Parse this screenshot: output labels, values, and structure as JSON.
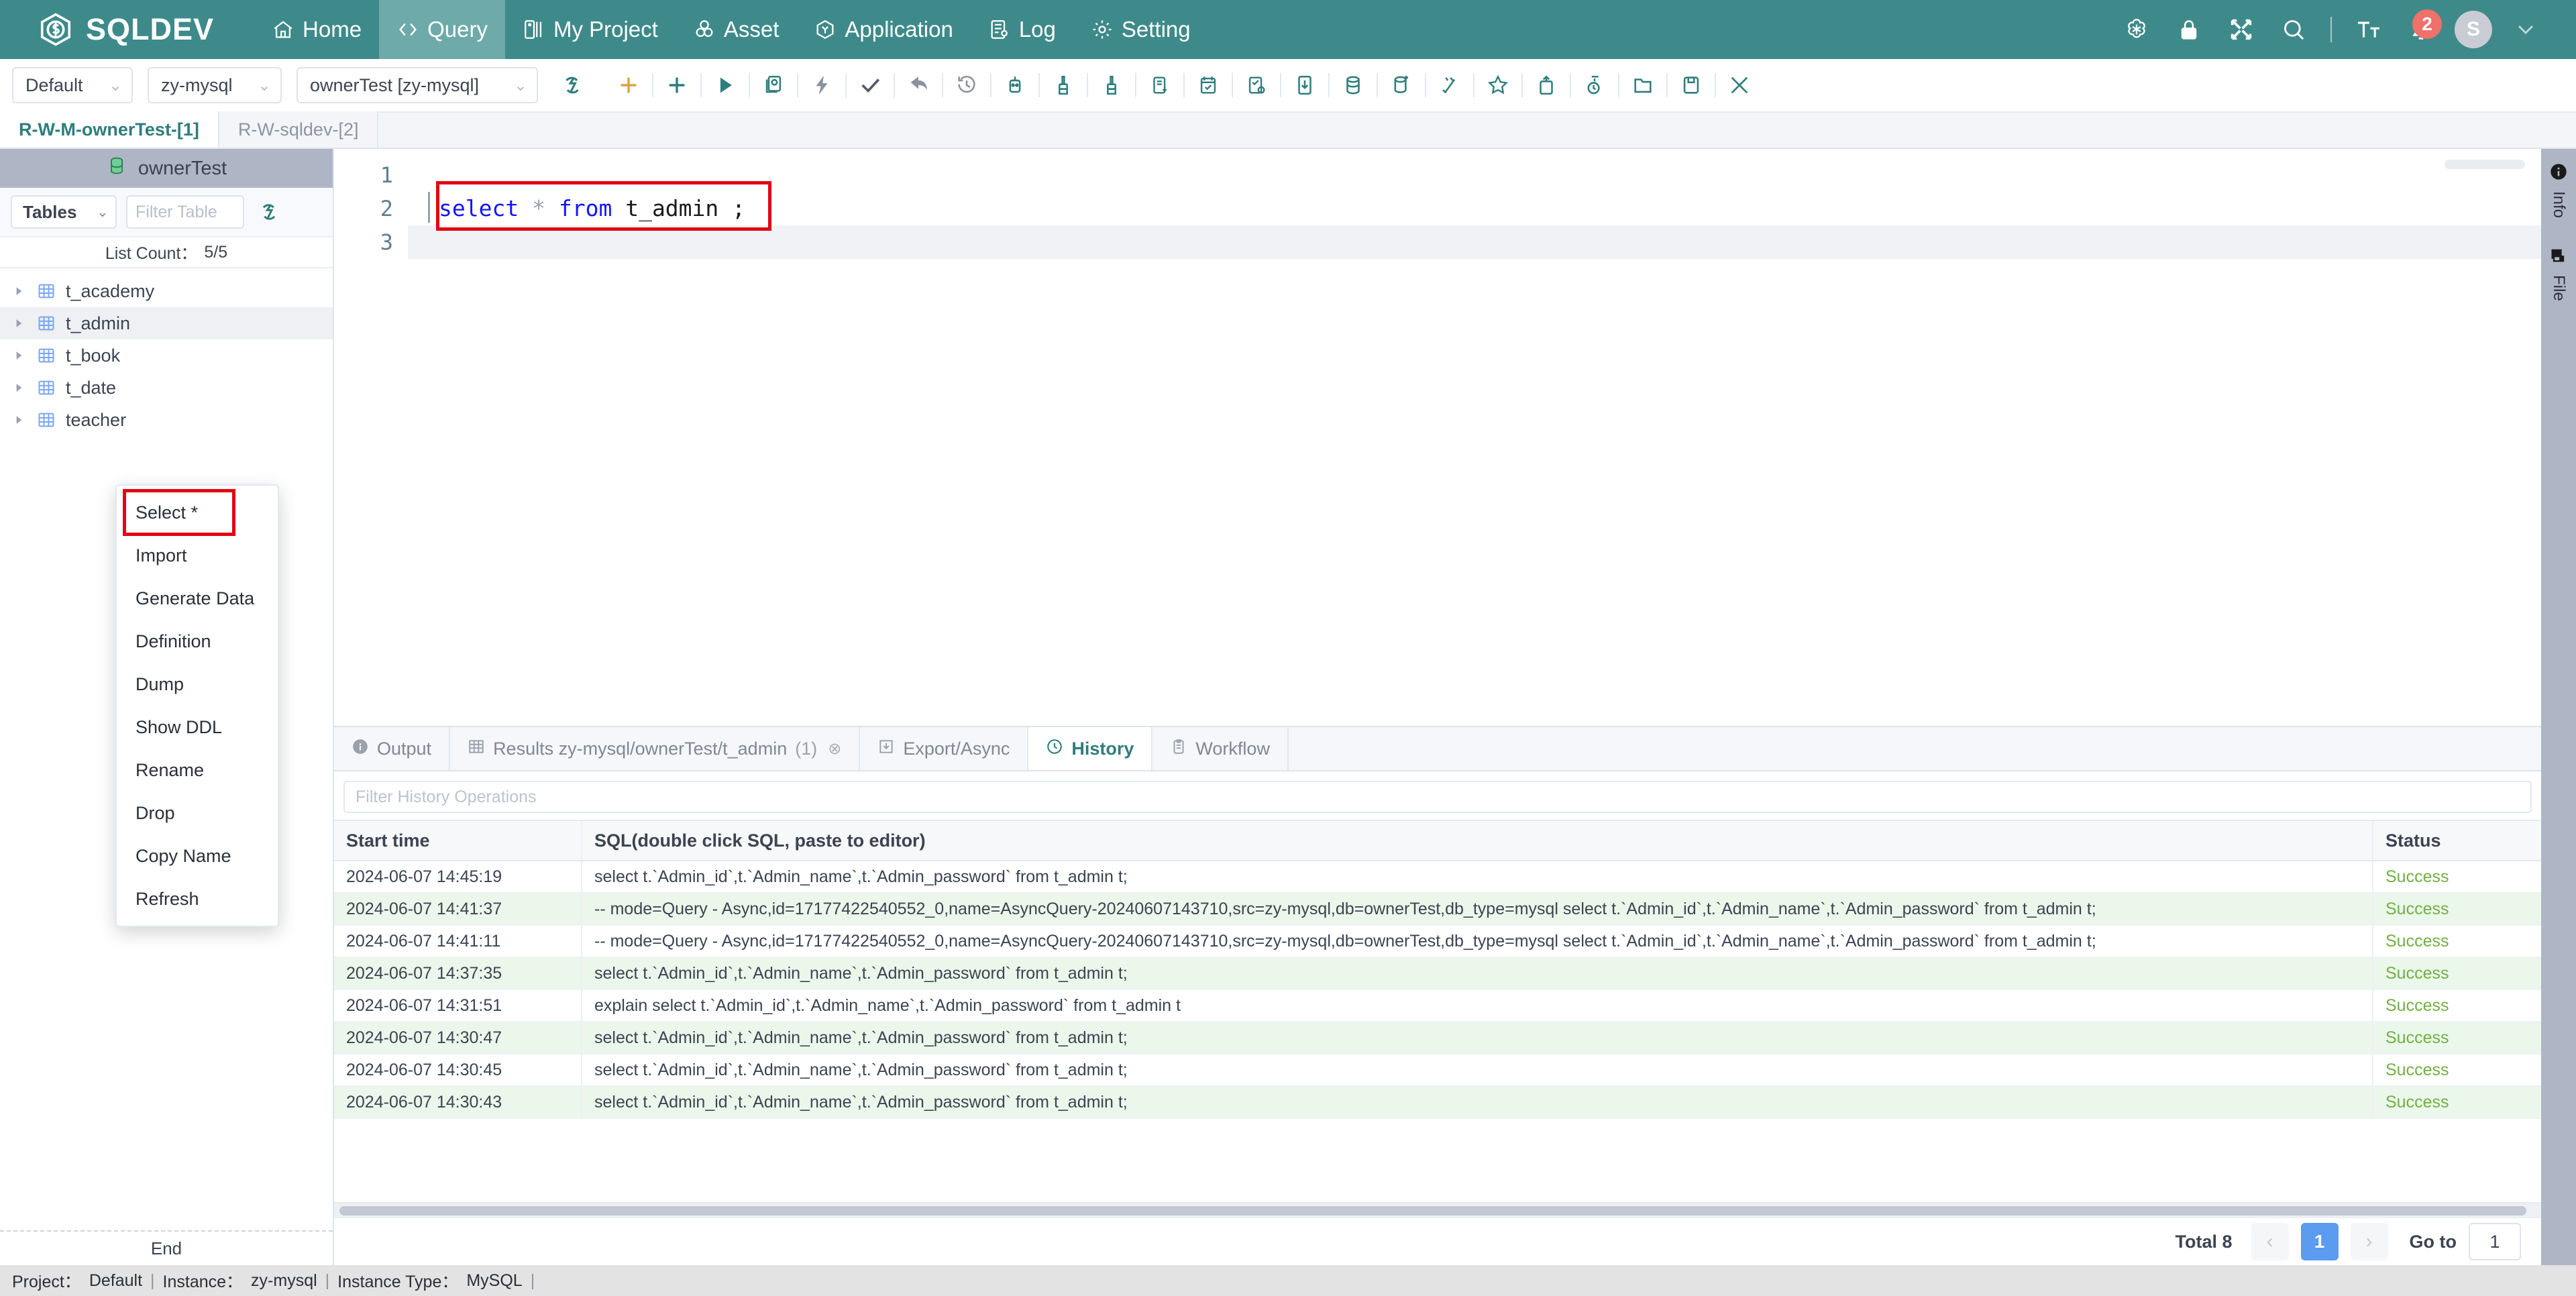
{
  "brand": {
    "name": "SQLDEV",
    "logo_icon": "sqldev-logo-icon"
  },
  "topnav": {
    "items": [
      {
        "label": "Home",
        "icon": "home-icon",
        "active": false
      },
      {
        "label": "Query",
        "icon": "code-icon",
        "active": true
      },
      {
        "label": "My Project",
        "icon": "project-icon",
        "active": false
      },
      {
        "label": "Asset",
        "icon": "asset-icon",
        "active": false
      },
      {
        "label": "Application",
        "icon": "application-icon",
        "active": false
      },
      {
        "label": "Log",
        "icon": "log-icon",
        "active": false
      },
      {
        "label": "Setting",
        "icon": "gear-icon",
        "active": false
      }
    ],
    "right_icons": [
      "ai-icon",
      "lock-icon",
      "fullscreen-icon",
      "search-icon",
      "font-size-icon",
      "bell-icon"
    ],
    "notification_count": "2",
    "avatar_letter": "S"
  },
  "toolbar": {
    "project_select": {
      "value": "Default",
      "caret": "chevron-down-icon"
    },
    "instance_select": {
      "value": "zy-mysql",
      "caret": "chevron-down-icon"
    },
    "database_select": {
      "value": "ownerTest [zy-mysql]",
      "caret": "chevron-down-icon"
    },
    "icons": [
      "refresh-connection-icon",
      "new-tab-plus-icon",
      "add-plus-icon",
      "run-icon",
      "explain-icon",
      "run-current-icon",
      "check-icon",
      "undo-icon",
      "history-icon",
      "format-icon",
      "beautify-icon",
      "brush-icon",
      "copy-add-icon",
      "plan-check-icon",
      "task-check-icon",
      "download-icon",
      "database-icon",
      "database-add-icon",
      "random-icon",
      "favorite-icon",
      "upload-icon",
      "timer-icon",
      "folder-icon",
      "save-icon",
      "tools-icon"
    ]
  },
  "editor_tabs": [
    {
      "label": "R-W-M-ownerTest-[1]",
      "active": true
    },
    {
      "label": "R-W-sqldev-[2]",
      "active": false
    }
  ],
  "sidebar": {
    "database_name": "ownerTest",
    "database_icon": "database-icon",
    "kind_select": {
      "value": "Tables",
      "caret": "chevron-down-icon"
    },
    "filter_placeholder": "Filter Table",
    "refresh_icon": "refresh-icon",
    "list_count_label": "List Count：",
    "list_count_value": "5/5",
    "tables": [
      {
        "name": "t_academy",
        "selected": false
      },
      {
        "name": "t_admin",
        "selected": true
      },
      {
        "name": "t_book",
        "selected": false
      },
      {
        "name": "t_date",
        "selected": false
      },
      {
        "name": "teacher",
        "selected": false
      }
    ],
    "end_label": "End"
  },
  "context_menu": {
    "items": [
      {
        "label": "Select *",
        "highlighted": true
      },
      {
        "label": "Import",
        "highlighted": false
      },
      {
        "label": "Generate Data",
        "highlighted": false
      },
      {
        "label": "Definition",
        "highlighted": false
      },
      {
        "label": "Dump",
        "highlighted": false
      },
      {
        "label": "Show DDL",
        "highlighted": false
      },
      {
        "label": "Rename",
        "highlighted": false
      },
      {
        "label": "Drop",
        "highlighted": false
      },
      {
        "label": "Copy Name",
        "highlighted": false
      },
      {
        "label": "Refresh",
        "highlighted": false
      }
    ]
  },
  "editor": {
    "line_numbers": [
      "1",
      "2",
      "3"
    ],
    "sql_tokens": {
      "kw_select": "select",
      "star": "*",
      "kw_from": "from",
      "table": "t_admin",
      "semicolon": ";"
    },
    "sql_text": "select * from t_admin ;"
  },
  "bottom_tabs": [
    {
      "label": "Output",
      "icon": "info-icon",
      "active": false
    },
    {
      "label": "Results zy-mysql/ownerTest/t_admin",
      "count": "(1)",
      "icon": "grid-icon",
      "active": false,
      "closeable": true
    },
    {
      "label": "Export/Async",
      "icon": "export-icon",
      "active": false
    },
    {
      "label": "History",
      "icon": "clock-icon",
      "active": true
    },
    {
      "label": "Workflow",
      "icon": "workflow-icon",
      "active": false
    }
  ],
  "history": {
    "filter_placeholder": "Filter History Operations",
    "columns": [
      "Start time",
      "SQL(double click SQL, paste to editor)",
      "Status"
    ],
    "rows": [
      {
        "time": "2024-06-07 14:45:19",
        "sql": "select t.`Admin_id`,t.`Admin_name`,t.`Admin_password` from t_admin t;",
        "status": "Success"
      },
      {
        "time": "2024-06-07 14:41:37",
        "sql": "-- mode=Query - Async,id=17177422540552_0,name=AsyncQuery-20240607143710,src=zy-mysql,db=ownerTest,db_type=mysql select t.`Admin_id`,t.`Admin_name`,t.`Admin_password` from t_admin t;",
        "status": "Success"
      },
      {
        "time": "2024-06-07 14:41:11",
        "sql": "-- mode=Query - Async,id=17177422540552_0,name=AsyncQuery-20240607143710,src=zy-mysql,db=ownerTest,db_type=mysql select t.`Admin_id`,t.`Admin_name`,t.`Admin_password` from t_admin t;",
        "status": "Success"
      },
      {
        "time": "2024-06-07 14:37:35",
        "sql": "select t.`Admin_id`,t.`Admin_name`,t.`Admin_password` from t_admin t;",
        "status": "Success"
      },
      {
        "time": "2024-06-07 14:31:51",
        "sql": "explain select t.`Admin_id`,t.`Admin_name`,t.`Admin_password` from t_admin t",
        "status": "Success"
      },
      {
        "time": "2024-06-07 14:30:47",
        "sql": "select t.`Admin_id`,t.`Admin_name`,t.`Admin_password` from t_admin t;",
        "status": "Success"
      },
      {
        "time": "2024-06-07 14:30:45",
        "sql": "select t.`Admin_id`,t.`Admin_name`,t.`Admin_password` from t_admin t;",
        "status": "Success"
      },
      {
        "time": "2024-06-07 14:30:43",
        "sql": "select t.`Admin_id`,t.`Admin_name`,t.`Admin_password` from t_admin t;",
        "status": "Success"
      }
    ]
  },
  "pagination": {
    "total_label": "Total 8",
    "prev_icon": "chevron-left-icon",
    "next_icon": "chevron-right-icon",
    "current_page": "1",
    "goto_label": "Go to",
    "goto_value": "1"
  },
  "right_rail": [
    {
      "label": "Info",
      "icon": "info-icon"
    },
    {
      "label": "File",
      "icon": "file-icon"
    }
  ],
  "statusbar": {
    "project_label": "Project：",
    "project_value": "Default",
    "instance_label": "Instance：",
    "instance_value": "zy-mysql",
    "type_label": "Instance Type：",
    "type_value": "MySQL",
    "sep": "|"
  },
  "colors": {
    "brand_teal": "#3e8a8a",
    "accent_teal": "#2f7d7d",
    "highlight_red": "#e30613",
    "success_green": "#72b043",
    "page_blue": "#5b9bf0",
    "rail_gray": "#aeb6c6"
  }
}
